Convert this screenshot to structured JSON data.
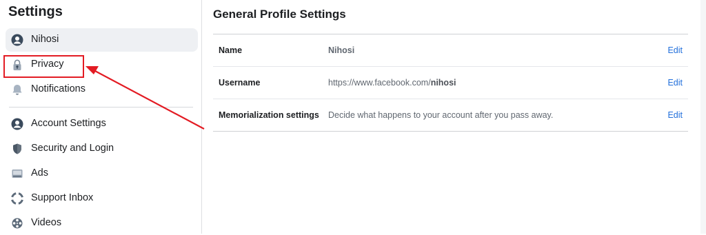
{
  "sidebar": {
    "title": "Settings",
    "items": [
      {
        "label": "Nihosi",
        "icon": "profile-icon"
      },
      {
        "label": "Privacy",
        "icon": "lock-icon"
      },
      {
        "label": "Notifications",
        "icon": "bell-icon"
      },
      {
        "label": "Account Settings",
        "icon": "account-icon"
      },
      {
        "label": "Security and Login",
        "icon": "shield-icon"
      },
      {
        "label": "Ads",
        "icon": "ads-icon"
      },
      {
        "label": "Support Inbox",
        "icon": "lifebuoy-icon"
      },
      {
        "label": "Videos",
        "icon": "video-reel-icon"
      }
    ]
  },
  "main": {
    "title": "General Profile Settings",
    "rows": [
      {
        "label": "Name",
        "value": "Nihosi",
        "edit": "Edit"
      },
      {
        "label": "Username",
        "value_prefix": "https://www.facebook.com/",
        "value_bold": "nihosi",
        "edit": "Edit"
      },
      {
        "label": "Memorialization settings",
        "value": "Decide what happens to your account after you pass away.",
        "edit": "Edit"
      }
    ]
  },
  "colors": {
    "annotation": "#e31b23",
    "link": "#216fdb",
    "active_bg": "#eef0f3"
  }
}
